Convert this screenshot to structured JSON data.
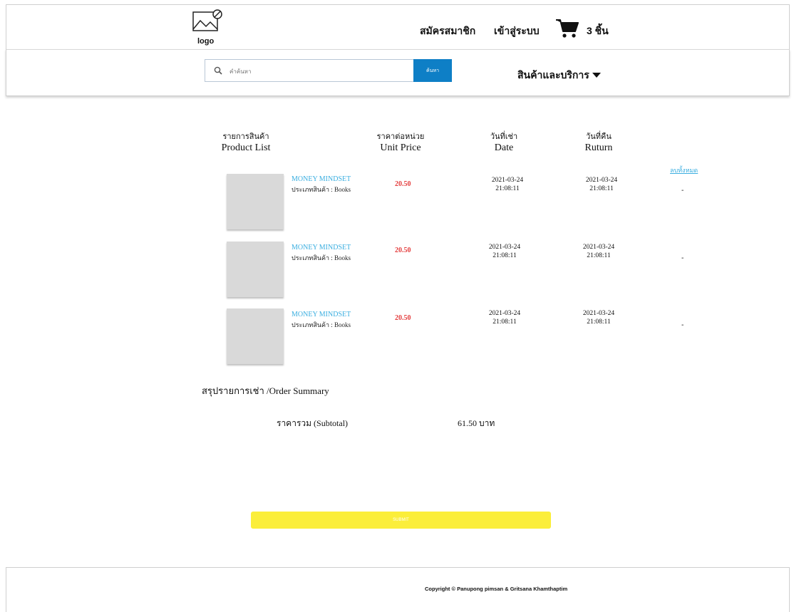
{
  "header": {
    "logo_label": "logo",
    "register": "สมัครสมาชิก",
    "login": "เข้าสู่ระบบ",
    "cart_count": "3 ชิ้น",
    "cart_icon": "cart-icon"
  },
  "search": {
    "placeholder": "คำค้นหา",
    "button_label": "ค้นหา",
    "menu_label": "สินค้าและบริการ"
  },
  "table": {
    "headers": [
      {
        "th": "รายการสินค้า",
        "en": "Product List"
      },
      {
        "th": "ราคาต่อหน่วย",
        "en": "Unit Price"
      },
      {
        "th": "วันที่เช่า",
        "en": "Date"
      },
      {
        "th": "วันที่คืน",
        "en": "Ruturn"
      }
    ],
    "remove_all": "ลบทั้งหมด",
    "rows": [
      {
        "name": "MONEY MINDSET",
        "type": "ประเภทสินค้า : Books",
        "price": "20.50",
        "date": "2021-03-24",
        "date_time": "21:08:11",
        "return": "2021-03-24",
        "return_time": "21:08:11",
        "action": "-"
      },
      {
        "name": "MONEY MINDSET",
        "type": "ประเภทสินค้า : Books",
        "price": "20.50",
        "date": "2021-03-24",
        "date_time": "21:08:11",
        "return": "2021-03-24",
        "return_time": "21:08:11",
        "action": "-"
      },
      {
        "name": "MONEY MINDSET",
        "type": "ประเภทสินค้า : Books",
        "price": "20.50",
        "date": "2021-03-24",
        "date_time": "21:08:11",
        "return": "2021-03-24",
        "return_time": "21:08:11",
        "action": "-"
      }
    ]
  },
  "summary": {
    "title": "สรุปรายการเช่า /Order Summary",
    "subtotal_label": "ราคารวม (Subtotal)",
    "subtotal_value": "61.50 บาท"
  },
  "submit_label": "SUBMIT",
  "footer": {
    "copyright": "Copyright © Panupong pimsan &  Gritsana Khamthaptim"
  },
  "colors": {
    "accent_blue": "#0e7fc6",
    "link_blue": "#3aaee0",
    "price_red": "#e43d3d",
    "submit_yellow": "#fbee3a"
  }
}
